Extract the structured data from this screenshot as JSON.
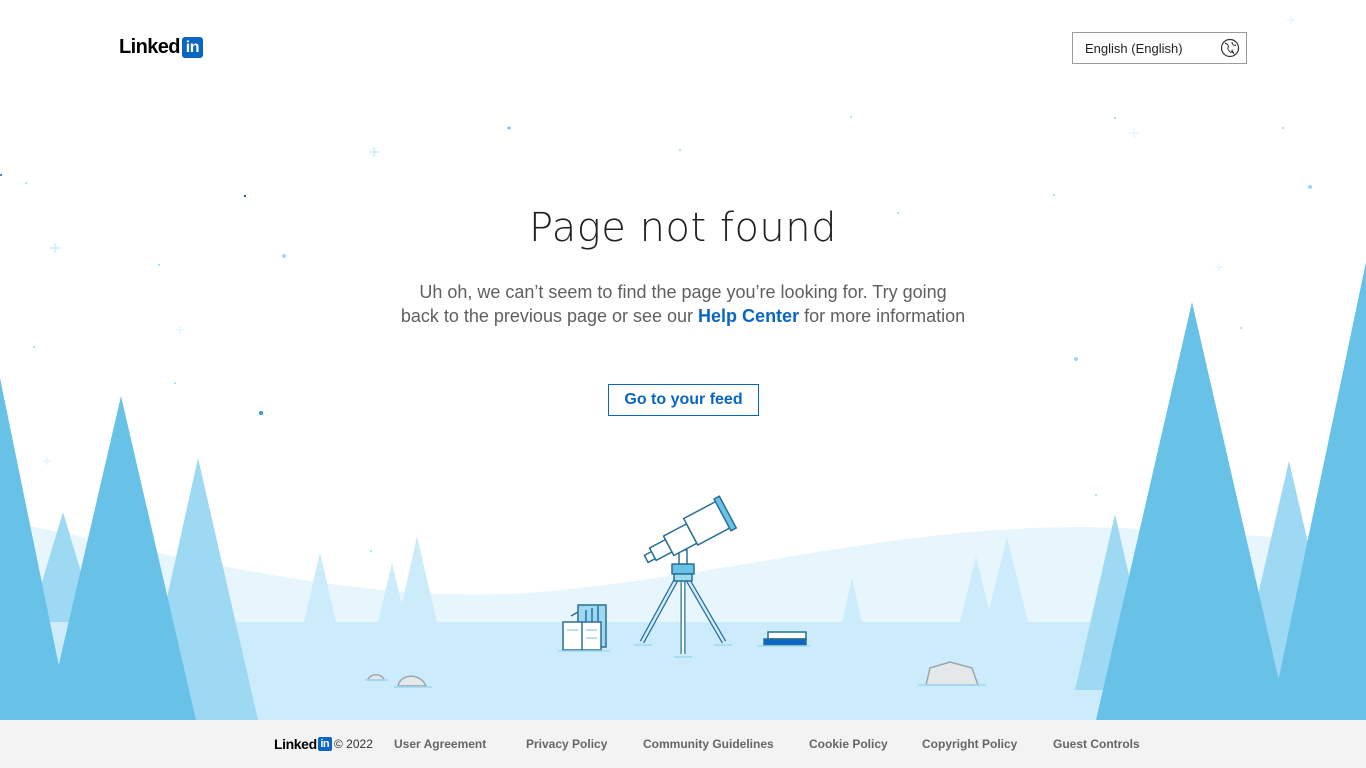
{
  "header": {
    "logo_text": "Linked",
    "logo_badge": "in",
    "language_select": {
      "value": "English (English)",
      "icon": "globe-icon"
    }
  },
  "main": {
    "title": "Page not found",
    "message_before": "Uh oh, we can’t seem to find the page you’re looking for. Try going back to the previous page or see our ",
    "help_link": "Help Center",
    "message_after": " for more information",
    "feed_button": "Go to your feed"
  },
  "footer": {
    "logo_text": "Linked",
    "logo_badge": "in",
    "copyright": "© 2022",
    "links": {
      "user_agreement": "User Agreement",
      "privacy_policy": "Privacy Policy",
      "community_guidelines": "Community Guidelines",
      "cookie_policy": "Cookie Policy",
      "copyright_policy": "Copyright Policy",
      "guest_controls": "Guest Controls"
    }
  },
  "colors": {
    "brand_blue": "#0a66c2",
    "tree_dark": "#68c2e8",
    "tree_light": "#9dd9f3",
    "snow": "#cdecfb"
  }
}
